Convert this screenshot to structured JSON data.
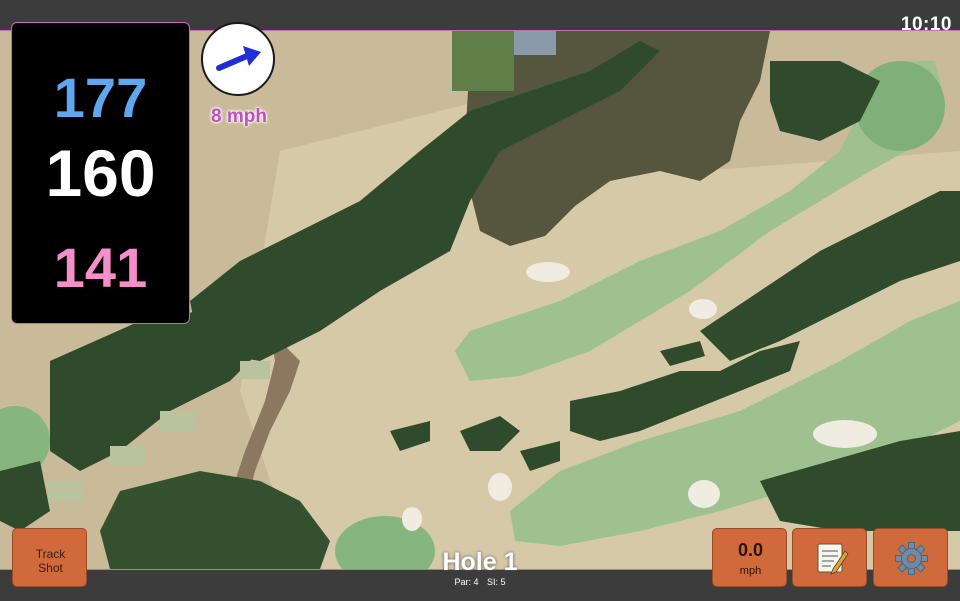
{
  "status": {
    "time": "10:10"
  },
  "distances": {
    "back": "177",
    "middle": "160",
    "front": "141"
  },
  "wind": {
    "speed_label": "8 mph",
    "icon": "wind-direction-arrow-icon"
  },
  "actions": {
    "track_shot_line1": "Track",
    "track_shot_line2": "Shot",
    "speed_value": "0.0",
    "speed_unit": "mph",
    "notes_icon": "notepad-icon",
    "settings_icon": "gear-icon"
  },
  "hole": {
    "title": "Hole 1",
    "par": "Par: 4",
    "si": "SI: 5"
  },
  "colors": {
    "back": "#5fa8ef",
    "middle": "#ffffff",
    "front": "#f48fc9",
    "button": "#d06a3a",
    "wind_label": "#c04ec0",
    "accent_border": "#c76cc0"
  }
}
